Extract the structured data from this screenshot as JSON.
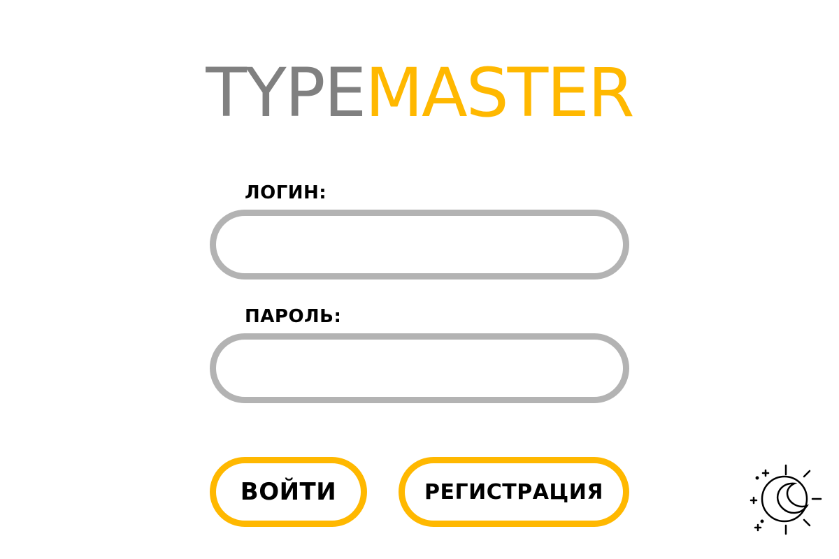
{
  "logo": {
    "part1": "TYPE",
    "part2": "MASTER"
  },
  "form": {
    "login_label": "ЛОГИН:",
    "login_value": "",
    "password_label": "ПАРОЛЬ:",
    "password_value": ""
  },
  "buttons": {
    "login": "ВОЙТИ",
    "register": "РЕГИСТРАЦИЯ"
  },
  "theme_toggle": {
    "icon": "moon-sun-icon"
  },
  "colors": {
    "accent": "#ffb800",
    "logo_gray": "#808080",
    "field_border": "#b3b3b3",
    "text": "#000000",
    "background": "#ffffff"
  }
}
